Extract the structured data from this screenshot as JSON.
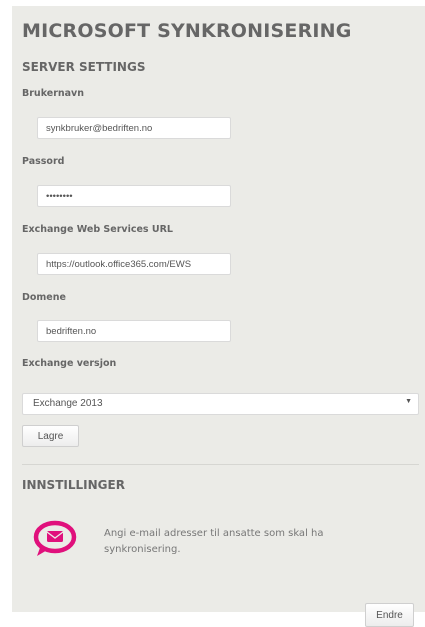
{
  "title": "MICROSOFT SYNKRONISERING",
  "server_settings": {
    "heading": "SERVER SETTINGS",
    "username": {
      "label": "Brukernavn",
      "value": "synkbruker@bedriften.no"
    },
    "password": {
      "label": "Passord",
      "value": "••••••••"
    },
    "ews_url": {
      "label": "Exchange Web Services URL",
      "value": "https://outlook.office365.com/EWS"
    },
    "domain": {
      "label": "Domene",
      "value": "bedriften.no"
    },
    "exchange_version": {
      "label": "Exchange versjon",
      "selected": "Exchange 2013"
    },
    "save_label": "Lagre"
  },
  "settings": {
    "heading": "INNSTILLINGER",
    "description": "Angi e-mail adresser til ansatte som skal ha synkronisering.",
    "edit_label": "Endre",
    "icon": "mail-chat-icon"
  },
  "colors": {
    "accent": "#e0107c",
    "panel_background": "#ebebe7"
  }
}
